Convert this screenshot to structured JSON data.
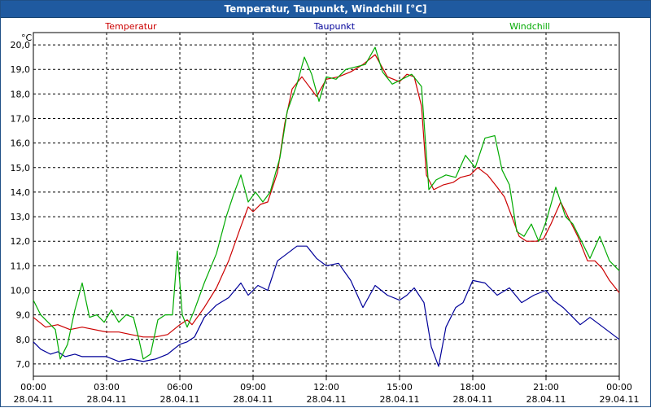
{
  "window": {
    "title": "Temperatur, Taupunkt, Windchill [°C]"
  },
  "chart_data": {
    "type": "line",
    "title": "Temperatur, Taupunkt, Windchill [°C]",
    "ylabel": "°C",
    "ylim": [
      6.5,
      20.5
    ],
    "yticks": [
      "20,0",
      "19,0",
      "18,0",
      "17,0",
      "16,0",
      "15,0",
      "14,0",
      "13,0",
      "12,0",
      "11,0",
      "10,0",
      "9,0",
      "8,0",
      "7,0"
    ],
    "ytick_values": [
      20,
      19,
      18,
      17,
      16,
      15,
      14,
      13,
      12,
      11,
      10,
      9,
      8,
      7
    ],
    "xlim_hours": [
      0,
      24
    ],
    "xticks": [
      {
        "hours": 0,
        "time": "00:00",
        "date": "28.04.11"
      },
      {
        "hours": 3,
        "time": "03:00",
        "date": "28.04.11"
      },
      {
        "hours": 6,
        "time": "06:00",
        "date": "28.04.11"
      },
      {
        "hours": 9,
        "time": "09:00",
        "date": "28.04.11"
      },
      {
        "hours": 12,
        "time": "12:00",
        "date": "28.04.11"
      },
      {
        "hours": 15,
        "time": "15:00",
        "date": "28.04.11"
      },
      {
        "hours": 18,
        "time": "18:00",
        "date": "28.04.11"
      },
      {
        "hours": 21,
        "time": "21:00",
        "date": "28.04.11"
      },
      {
        "hours": 24,
        "time": "00:00",
        "date": "29.04.11"
      }
    ],
    "grid": true,
    "series": [
      {
        "name": "Temperatur",
        "color": "#cc0000",
        "points": [
          [
            0,
            8.9
          ],
          [
            0.5,
            8.5
          ],
          [
            1,
            8.6
          ],
          [
            1.5,
            8.4
          ],
          [
            2,
            8.5
          ],
          [
            3,
            8.3
          ],
          [
            3.5,
            8.3
          ],
          [
            4,
            8.2
          ],
          [
            4.5,
            8.1
          ],
          [
            5,
            8.1
          ],
          [
            5.5,
            8.2
          ],
          [
            6,
            8.6
          ],
          [
            6.3,
            8.8
          ],
          [
            6.5,
            8.6
          ],
          [
            7,
            9.3
          ],
          [
            7.5,
            10.1
          ],
          [
            8,
            11.2
          ],
          [
            8.5,
            12.6
          ],
          [
            8.8,
            13.4
          ],
          [
            9,
            13.2
          ],
          [
            9.3,
            13.5
          ],
          [
            9.6,
            13.6
          ],
          [
            10,
            14.8
          ],
          [
            10.3,
            16.8
          ],
          [
            10.6,
            18.2
          ],
          [
            11,
            18.7
          ],
          [
            11.3,
            18.3
          ],
          [
            11.6,
            17.9
          ],
          [
            12,
            18.6
          ],
          [
            12.5,
            18.7
          ],
          [
            13,
            18.9
          ],
          [
            13.5,
            19.2
          ],
          [
            14,
            19.6
          ],
          [
            14.5,
            18.7
          ],
          [
            15,
            18.5
          ],
          [
            15.3,
            18.8
          ],
          [
            15.6,
            18.7
          ],
          [
            15.9,
            17.5
          ],
          [
            16.1,
            14.7
          ],
          [
            16.4,
            14.1
          ],
          [
            16.8,
            14.3
          ],
          [
            17.2,
            14.4
          ],
          [
            17.5,
            14.6
          ],
          [
            17.9,
            14.7
          ],
          [
            18.2,
            15.0
          ],
          [
            18.6,
            14.7
          ],
          [
            19,
            14.2
          ],
          [
            19.3,
            13.8
          ],
          [
            19.6,
            13.0
          ],
          [
            19.9,
            12.2
          ],
          [
            20.2,
            12.0
          ],
          [
            20.6,
            12.0
          ],
          [
            20.9,
            12.1
          ],
          [
            21.2,
            12.7
          ],
          [
            21.6,
            13.6
          ],
          [
            21.9,
            13.0
          ],
          [
            22.3,
            12.2
          ],
          [
            22.7,
            11.2
          ],
          [
            23,
            11.2
          ],
          [
            23.3,
            10.9
          ],
          [
            23.6,
            10.4
          ],
          [
            24,
            9.9
          ]
        ]
      },
      {
        "name": "Taupunkt",
        "color": "#000099",
        "points": [
          [
            0,
            7.9
          ],
          [
            0.3,
            7.6
          ],
          [
            0.7,
            7.4
          ],
          [
            1,
            7.5
          ],
          [
            1.3,
            7.3
          ],
          [
            1.7,
            7.4
          ],
          [
            2,
            7.3
          ],
          [
            2.5,
            7.3
          ],
          [
            3,
            7.3
          ],
          [
            3.5,
            7.1
          ],
          [
            4,
            7.2
          ],
          [
            4.5,
            7.1
          ],
          [
            5,
            7.2
          ],
          [
            5.5,
            7.4
          ],
          [
            6,
            7.8
          ],
          [
            6.3,
            7.9
          ],
          [
            6.6,
            8.1
          ],
          [
            7,
            8.9
          ],
          [
            7.5,
            9.4
          ],
          [
            8,
            9.7
          ],
          [
            8.5,
            10.3
          ],
          [
            8.8,
            9.8
          ],
          [
            9.2,
            10.2
          ],
          [
            9.6,
            10.0
          ],
          [
            10,
            11.2
          ],
          [
            10.4,
            11.5
          ],
          [
            10.8,
            11.8
          ],
          [
            11.2,
            11.8
          ],
          [
            11.6,
            11.3
          ],
          [
            12,
            11.0
          ],
          [
            12.5,
            11.1
          ],
          [
            13,
            10.4
          ],
          [
            13.5,
            9.3
          ],
          [
            14,
            10.2
          ],
          [
            14.5,
            9.8
          ],
          [
            15,
            9.6
          ],
          [
            15.3,
            9.8
          ],
          [
            15.6,
            10.1
          ],
          [
            16,
            9.5
          ],
          [
            16.3,
            7.7
          ],
          [
            16.6,
            6.9
          ],
          [
            16.9,
            8.5
          ],
          [
            17.3,
            9.3
          ],
          [
            17.6,
            9.5
          ],
          [
            18,
            10.4
          ],
          [
            18.5,
            10.3
          ],
          [
            19,
            9.8
          ],
          [
            19.5,
            10.1
          ],
          [
            20,
            9.5
          ],
          [
            20.5,
            9.8
          ],
          [
            21,
            10.0
          ],
          [
            21.3,
            9.6
          ],
          [
            21.7,
            9.3
          ],
          [
            22,
            9.0
          ],
          [
            22.4,
            8.6
          ],
          [
            22.8,
            8.9
          ],
          [
            23.2,
            8.6
          ],
          [
            23.6,
            8.3
          ],
          [
            24,
            8.0
          ]
        ]
      },
      {
        "name": "Windchill",
        "color": "#00aa00",
        "points": [
          [
            0,
            9.6
          ],
          [
            0.3,
            9.0
          ],
          [
            0.6,
            8.7
          ],
          [
            0.9,
            8.4
          ],
          [
            1.1,
            7.2
          ],
          [
            1.4,
            7.8
          ],
          [
            1.7,
            9.2
          ],
          [
            2,
            10.3
          ],
          [
            2.3,
            8.9
          ],
          [
            2.6,
            9.0
          ],
          [
            2.9,
            8.7
          ],
          [
            3.2,
            9.2
          ],
          [
            3.5,
            8.7
          ],
          [
            3.8,
            9.0
          ],
          [
            4.1,
            8.9
          ],
          [
            4.3,
            8.1
          ],
          [
            4.5,
            7.2
          ],
          [
            4.8,
            7.4
          ],
          [
            5.1,
            8.8
          ],
          [
            5.4,
            9.0
          ],
          [
            5.7,
            9.0
          ],
          [
            5.9,
            11.6
          ],
          [
            6.1,
            9.0
          ],
          [
            6.3,
            8.5
          ],
          [
            6.6,
            9.2
          ],
          [
            7,
            10.3
          ],
          [
            7.5,
            11.5
          ],
          [
            7.9,
            13.0
          ],
          [
            8.2,
            13.9
          ],
          [
            8.5,
            14.7
          ],
          [
            8.8,
            13.6
          ],
          [
            9.1,
            14.0
          ],
          [
            9.4,
            13.6
          ],
          [
            9.7,
            14.0
          ],
          [
            10.1,
            15.4
          ],
          [
            10.4,
            17.3
          ],
          [
            10.8,
            18.4
          ],
          [
            11.1,
            19.5
          ],
          [
            11.4,
            18.8
          ],
          [
            11.7,
            17.7
          ],
          [
            12,
            18.7
          ],
          [
            12.4,
            18.6
          ],
          [
            12.8,
            19.0
          ],
          [
            13.2,
            19.1
          ],
          [
            13.6,
            19.2
          ],
          [
            14,
            19.9
          ],
          [
            14.3,
            18.9
          ],
          [
            14.7,
            18.4
          ],
          [
            15.1,
            18.6
          ],
          [
            15.5,
            18.8
          ],
          [
            15.9,
            18.3
          ],
          [
            16.2,
            14.1
          ],
          [
            16.5,
            14.5
          ],
          [
            16.9,
            14.7
          ],
          [
            17.3,
            14.6
          ],
          [
            17.7,
            15.5
          ],
          [
            18.1,
            15.0
          ],
          [
            18.5,
            16.2
          ],
          [
            18.9,
            16.3
          ],
          [
            19.2,
            14.9
          ],
          [
            19.5,
            14.3
          ],
          [
            19.8,
            12.4
          ],
          [
            20.1,
            12.2
          ],
          [
            20.4,
            12.7
          ],
          [
            20.7,
            12.0
          ],
          [
            21,
            12.8
          ],
          [
            21.4,
            14.2
          ],
          [
            21.8,
            13.0
          ],
          [
            22.1,
            12.7
          ],
          [
            22.4,
            12.1
          ],
          [
            22.8,
            11.3
          ],
          [
            23.2,
            12.2
          ],
          [
            23.6,
            11.2
          ],
          [
            24,
            10.8
          ]
        ]
      }
    ]
  }
}
